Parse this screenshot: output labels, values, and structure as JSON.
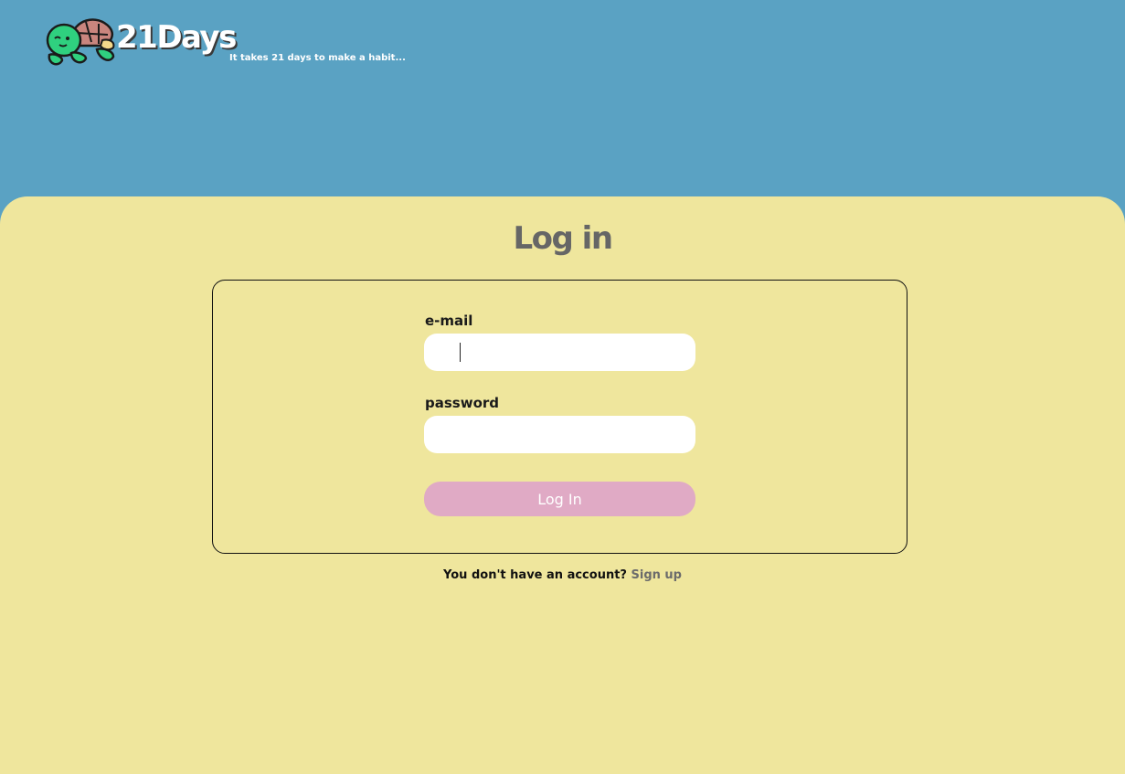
{
  "header": {
    "brand": "21Days",
    "tagline": "It takes 21 days to make a habit..."
  },
  "login": {
    "title": "Log in",
    "email_label": "e-mail",
    "email_value": "",
    "password_label": "password",
    "password_value": "",
    "button_label": "Log In"
  },
  "signup": {
    "prompt": "You don't have an account?",
    "link_label": "Sign up"
  },
  "colors": {
    "header_bg": "#5aa2c3",
    "panel_bg": "#efe69d",
    "button_bg": "#e0aac5",
    "title_text": "#666666"
  }
}
